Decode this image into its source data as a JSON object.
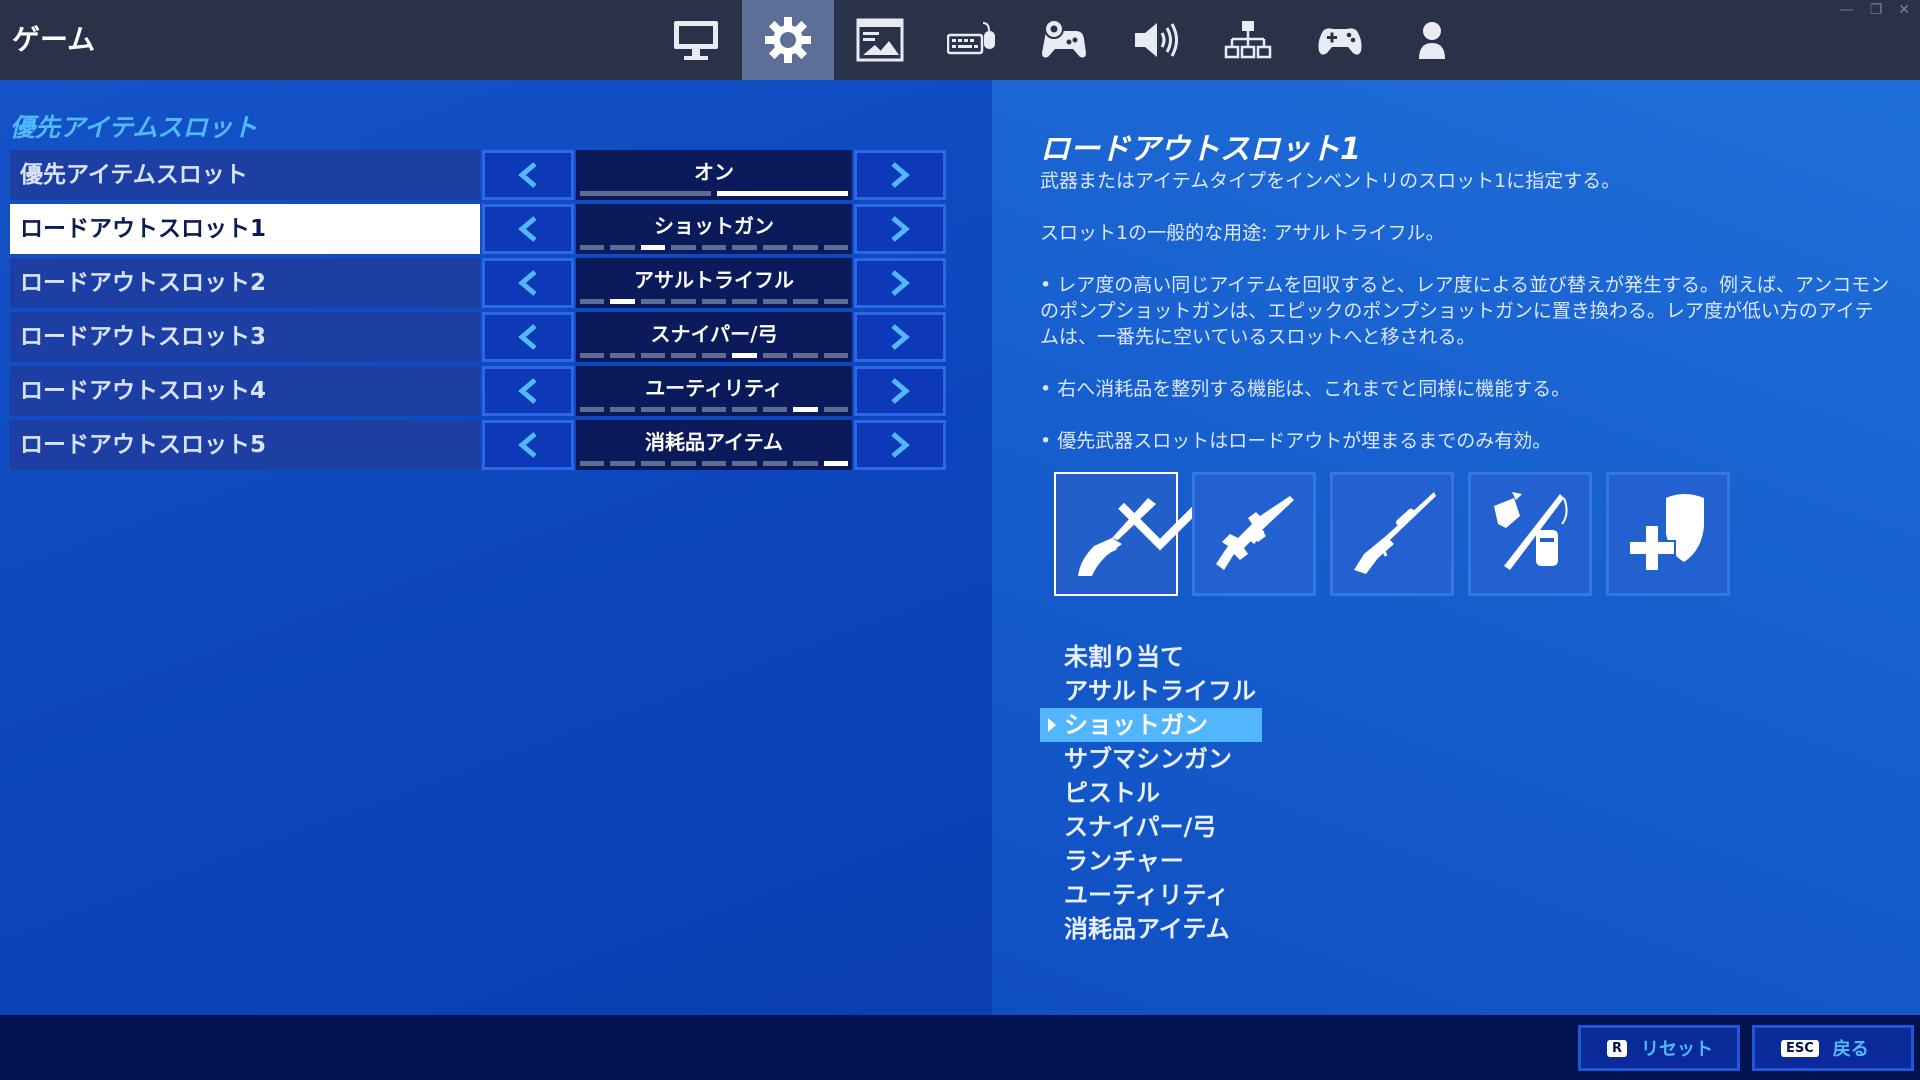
{
  "header": {
    "title": "ゲーム",
    "tabs": [
      {
        "id": "video",
        "icon": "monitor-icon"
      },
      {
        "id": "game",
        "icon": "gear-icon",
        "active": true
      },
      {
        "id": "hud",
        "icon": "hud-icon"
      },
      {
        "id": "keyboard",
        "icon": "keyboard-mouse-icon"
      },
      {
        "id": "controller-settings",
        "icon": "controller-gear-icon"
      },
      {
        "id": "audio",
        "icon": "speaker-icon"
      },
      {
        "id": "account",
        "icon": "network-icon"
      },
      {
        "id": "controller",
        "icon": "gamepad-icon"
      },
      {
        "id": "profile",
        "icon": "user-icon"
      }
    ],
    "window_controls": [
      "—",
      "❐",
      "✕"
    ]
  },
  "settings": {
    "section_title": "優先アイテムスロット",
    "rows": [
      {
        "label": "優先アイテムスロット",
        "value": "オン",
        "pips": 2,
        "active_pip": 1
      },
      {
        "label": "ロードアウトスロット1",
        "value": "ショットガン",
        "pips": 9,
        "active_pip": 2,
        "selected": true
      },
      {
        "label": "ロードアウトスロット2",
        "value": "アサルトライフル",
        "pips": 9,
        "active_pip": 1
      },
      {
        "label": "ロードアウトスロット3",
        "value": "スナイパー/弓",
        "pips": 9,
        "active_pip": 5
      },
      {
        "label": "ロードアウトスロット4",
        "value": "ユーティリティ",
        "pips": 9,
        "active_pip": 7
      },
      {
        "label": "ロードアウトスロット5",
        "value": "消耗品アイテム",
        "pips": 9,
        "active_pip": 8
      }
    ]
  },
  "description": {
    "title": "ロードアウトスロット1",
    "paragraphs": [
      "武器またはアイテムタイプをインベントリのスロット1に指定する。",
      "スロット1の一般的な用途: アサルトライフル。",
      "• レア度の高い同じアイテムを回収すると、レア度による並び替えが発生する。例えば、アンコモンのポンプショットガンは、エピックのポンプショットガンに置き換わる。レア度が低い方のアイテムは、一番先に空いているスロットへと移される。",
      "• 右へ消耗品を整列する機能は、これまでと同様に機能する。",
      "• 優先武器スロットはロードアウトが埋まるまでのみ有効。"
    ],
    "item_slots": [
      {
        "icon": "shotgun-icon",
        "selected": true
      },
      {
        "icon": "assault-rifle-icon"
      },
      {
        "icon": "sniper-rifle-icon"
      },
      {
        "icon": "utility-icon"
      },
      {
        "icon": "consumable-icon"
      }
    ],
    "options": [
      "未割り当て",
      "アサルトライフル",
      "ショットガン",
      "サブマシンガン",
      "ピストル",
      "スナイパー/弓",
      "ランチャー",
      "ユーティリティ",
      "消耗品アイテム"
    ],
    "selected_option": 2
  },
  "footer": {
    "reset": {
      "key": "R",
      "label": "リセット"
    },
    "back": {
      "key": "ESC",
      "label": "戻る"
    }
  },
  "colors": {
    "accent": "#52b8ff",
    "topbar": "#2a3249",
    "footer": "#02114f"
  }
}
